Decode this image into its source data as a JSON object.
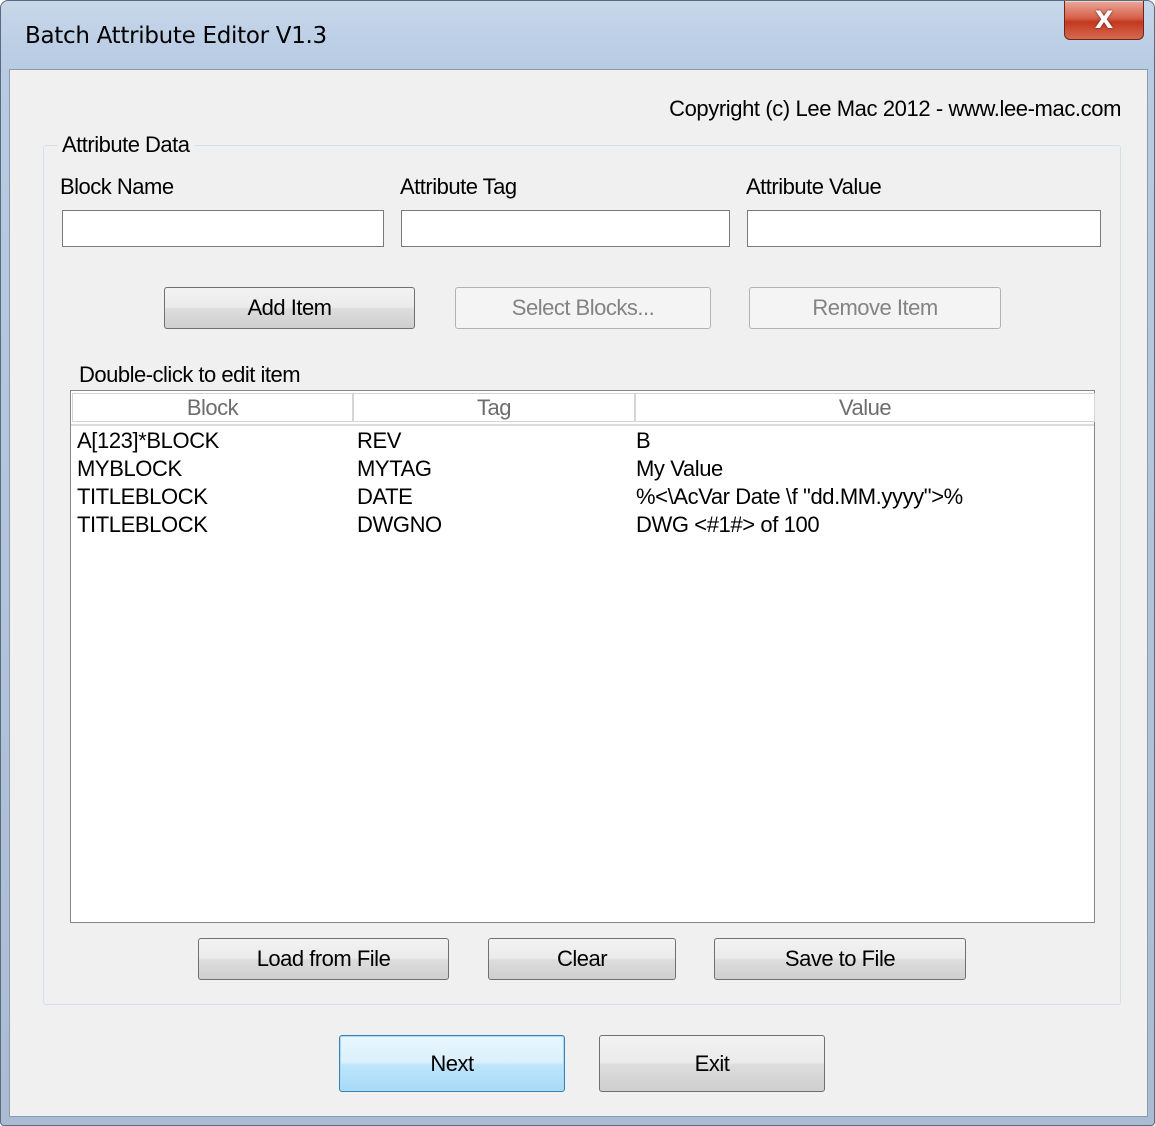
{
  "window": {
    "title": "Batch Attribute Editor V1.3",
    "close_glyph": "X"
  },
  "copyright": "Copyright (c) Lee Mac 2012  -  www.lee-mac.com",
  "group": {
    "label": "Attribute Data",
    "block_name_label": "Block Name",
    "attribute_tag_label": "Attribute Tag",
    "attribute_value_label": "Attribute Value",
    "block_name_value": "",
    "attribute_tag_value": "",
    "attribute_value_value": ""
  },
  "buttons": {
    "add_item": "Add Item",
    "select_blocks": "Select Blocks...",
    "remove_item": "Remove Item",
    "load_from_file": "Load from File",
    "clear": "Clear",
    "save_to_file": "Save to File",
    "next": "Next",
    "exit": "Exit"
  },
  "list": {
    "hint": "Double-click to edit item",
    "columns": [
      "Block",
      "Tag",
      "Value"
    ],
    "rows": [
      [
        "A[123]*BLOCK",
        "REV",
        "B"
      ],
      [
        "MYBLOCK",
        "MYTAG",
        "My Value"
      ],
      [
        "TITLEBLOCK",
        "DATE",
        "%<\\AcVar Date \\f \"dd.MM.yyyy\">%"
      ],
      [
        "TITLEBLOCK",
        "DWGNO",
        "DWG <#1#> of 100"
      ]
    ]
  },
  "colors": {
    "default_button_border": "#3c7fb1",
    "close_button": "#c2391f"
  }
}
